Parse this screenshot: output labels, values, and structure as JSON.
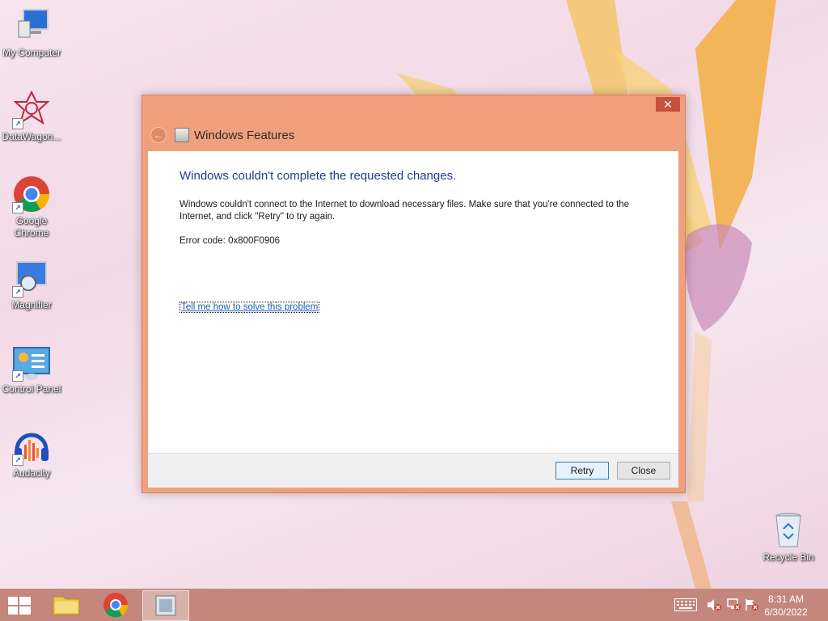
{
  "desktop": {
    "icons": [
      {
        "label": "My Computer"
      },
      {
        "label": "DataWagon..."
      },
      {
        "label": "Google Chrome"
      },
      {
        "label": "Magnifier"
      },
      {
        "label": "Control Panel"
      },
      {
        "label": "Audacity"
      },
      {
        "label": "Recycle Bin"
      }
    ]
  },
  "dialog": {
    "close_glyph": "✕",
    "back_glyph": "←",
    "title": "Windows Features",
    "heading": "Windows couldn't complete the requested changes.",
    "message": "Windows couldn't connect to the Internet to download necessary files. Make sure that you're connected to the Internet, and click \"Retry\" to try again.",
    "error_code": "Error code: 0x800F0906",
    "help_link": "Tell me how to solve this problem",
    "buttons": {
      "retry": "Retry",
      "close": "Close"
    }
  },
  "taskbar": {
    "apps": [
      "file-explorer-icon",
      "chrome-icon",
      "windows-features-icon"
    ],
    "clock": {
      "time": "8:31 AM",
      "date": "6/30/2022"
    }
  },
  "colors": {
    "dialog_frame": "#f0a07d",
    "heading": "#1e3d8f",
    "link": "#1a5fb4",
    "taskbar": "#c4877d"
  }
}
